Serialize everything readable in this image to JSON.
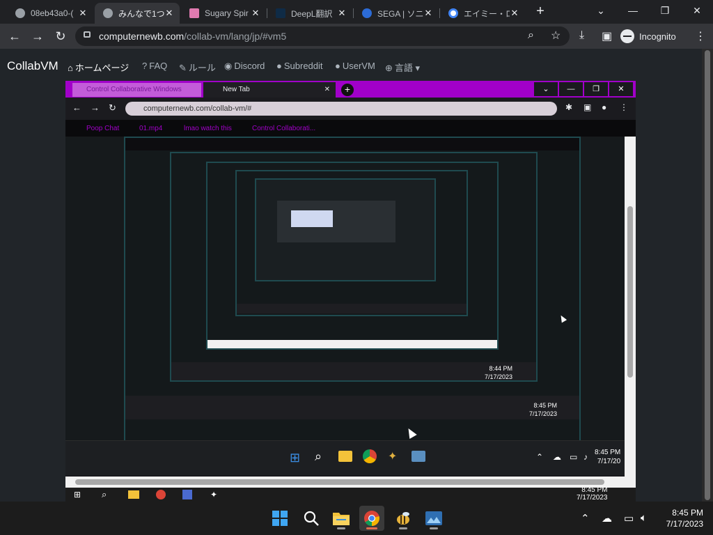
{
  "browser": {
    "tabs": [
      {
        "title": "08eb43a0-(",
        "active": false
      },
      {
        "title": "みんなで1つの",
        "active": true
      },
      {
        "title": "Sugary Spir",
        "active": false
      },
      {
        "title": "DeepL翻訳",
        "active": false
      },
      {
        "title": "SEGA | ソニ",
        "active": false
      },
      {
        "title": "エイミー・ローズ",
        "active": false
      }
    ],
    "new_tab_icon": "+",
    "url_host": "computernewb.com",
    "url_path": "/collab-vm/lang/jp/#vm5",
    "profile_label": "Incognito"
  },
  "site": {
    "brand": "CollabVM",
    "nav": [
      {
        "icon": "home-icon",
        "glyph": "⌂",
        "label": "ホームページ"
      },
      {
        "icon": "question-icon",
        "glyph": "?",
        "label": "FAQ"
      },
      {
        "icon": "rules-icon",
        "glyph": "✎",
        "label": "ルール"
      },
      {
        "icon": "discord-icon",
        "glyph": "◉",
        "label": "Discord"
      },
      {
        "icon": "reddit-icon",
        "glyph": "●",
        "label": "Subreddit"
      },
      {
        "icon": "user-icon",
        "glyph": "●",
        "label": "UserVM"
      },
      {
        "icon": "globe-icon",
        "glyph": "⊕",
        "label": "言語"
      }
    ]
  },
  "vm_screen": {
    "tab1_title": "Control Collaborative Windows",
    "tab2_title": "New Tab",
    "url": "computernewb.com/collab-vm/#",
    "bookmarks": [
      "Poop Chat",
      "01.mp4",
      "lmao watch this",
      "Control Collaborati..."
    ],
    "nested_time_1": "8:44 PM",
    "nested_time_2": "8:45 PM",
    "nested_date": "7/17/2023",
    "vm_time": "8:45 PM",
    "vm_date": "7/17/20",
    "remote_time": "8:45 PM",
    "remote_date": "7/17/2023"
  },
  "taskbar": {
    "apps": [
      "windows-start",
      "search",
      "file-explorer",
      "chrome",
      "app-bee",
      "photos"
    ],
    "time": "8:45 PM",
    "date": "7/17/2023"
  },
  "colors": {
    "vm_accent": "#a100c9",
    "page_bg": "#212529",
    "chrome_bg": "#202124"
  }
}
